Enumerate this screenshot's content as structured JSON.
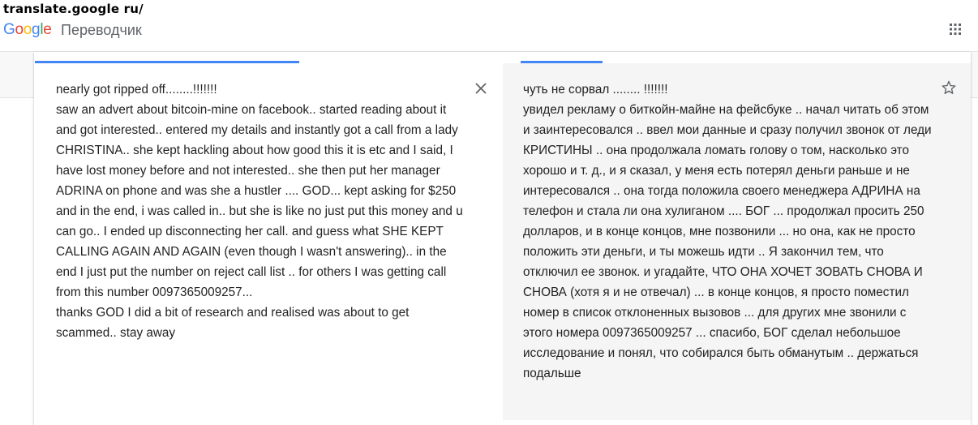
{
  "caption": "translate.google ru/",
  "header": {
    "logo_letters": [
      {
        "ch": "G",
        "color": "#4285f4"
      },
      {
        "ch": "o",
        "color": "#ea4335"
      },
      {
        "ch": "o",
        "color": "#fbbc05"
      },
      {
        "ch": "g",
        "color": "#4285f4"
      },
      {
        "ch": "l",
        "color": "#34a853"
      },
      {
        "ch": "e",
        "color": "#ea4335"
      }
    ],
    "product_name": "Переводчик",
    "apps_icon": "apps-grid-icon"
  },
  "tabs": {
    "accent_color": "#4285f4"
  },
  "source": {
    "text": "nearly got ripped off........!!!!!!!\nsaw an advert about bitcoin-mine on facebook.. started reading about it and got interested.. entered my details and instantly got a call from a lady CHRISTINA.. she kept hackling about how good this it is etc and I said, I have lost money before and not interested.. she then put her manager ADRINA on phone and was she a hustler .... GOD... kept asking for $250 and in the end, i was called in.. but she is like no just put this money and u can go.. I ended up disconnecting her call. and guess what SHE KEPT CALLING AGAIN AND AGAIN (even though I wasn't answering).. in the end I just put the number on reject call list .. for others I was getting call from this number 0097365009257...\nthanks GOD I did a bit of research and realised was about to get scammed.. stay away",
    "clear_icon": "close-icon"
  },
  "target": {
    "text": "чуть не сорвал ........ !!!!!!!\nувидел рекламу о биткойн-майне на фейсбуке .. начал читать об этом и заинтересовался .. ввел мои данные и сразу получил звонок от леди КРИСТИНЫ .. она продолжала ломать голову о том, насколько это хорошо и т. д., и я сказал, у меня есть потерял деньги раньше и не интересовался .. она тогда положила своего менеджера АДРИНА на телефон и стала ли она хулиганом .... БОГ ... продолжал просить 250 долларов, и в конце концов, мне позвонили ... но она, как не просто положить эти деньги, и ты можешь идти .. Я закончил тем, что отключил ее звонок. и угадайте, ЧТО ОНА ХОЧЕТ ЗОВАТЬ СНОВА И СНОВА (хотя я и не отвечал) ... в конце концов, я просто поместил номер в список отклоненных вызовов ... для других мне звонили с этого номера 0097365009257 ... спасибо, БОГ сделал небольшое исследование и понял, что собирался быть обманутым .. держаться подальше",
    "star_icon": "star-icon"
  }
}
